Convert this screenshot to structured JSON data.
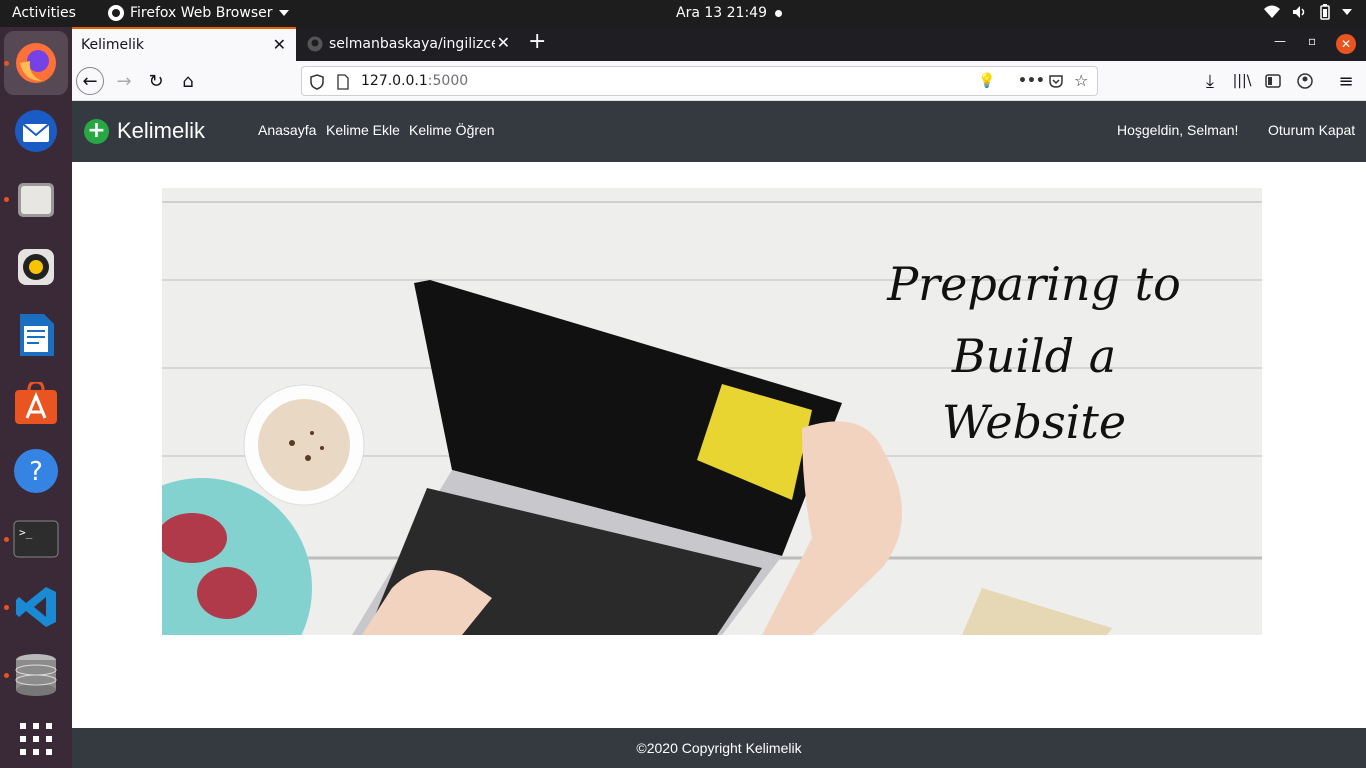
{
  "topbar": {
    "activities": "Activities",
    "app_name": "Firefox Web Browser",
    "clock": "Ara 13  21:49"
  },
  "dock": {
    "items": [
      "firefox-icon",
      "thunderbird-icon",
      "files-icon",
      "rhythmbox-icon",
      "writer-icon",
      "software-icon",
      "help-icon",
      "terminal-icon",
      "vscode-icon",
      "database-icon",
      "apps-grid-icon"
    ]
  },
  "browser": {
    "tabs": [
      {
        "label": "Kelimelik",
        "active": true
      },
      {
        "label": "selmanbaskaya/ingilizce",
        "active": false
      }
    ],
    "url_host": "127.0.0.1",
    "url_port": ":5000"
  },
  "site": {
    "brand": "Kelimelik",
    "nav": [
      "Anasayfa",
      "Kelime Ekle",
      "Kelime Öğren"
    ],
    "greeting": "Hoşgeldin, Selman!",
    "logout": "Oturum Kapat",
    "hero": {
      "line1": "Preparing to",
      "line2": "Build a",
      "line3": "Website"
    },
    "footer": "©2020 Copyright Kelimelik"
  },
  "colors": {
    "navbar_bg": "#343a40",
    "brand_accent": "#28a745",
    "ubuntu_orange": "#e95420"
  }
}
